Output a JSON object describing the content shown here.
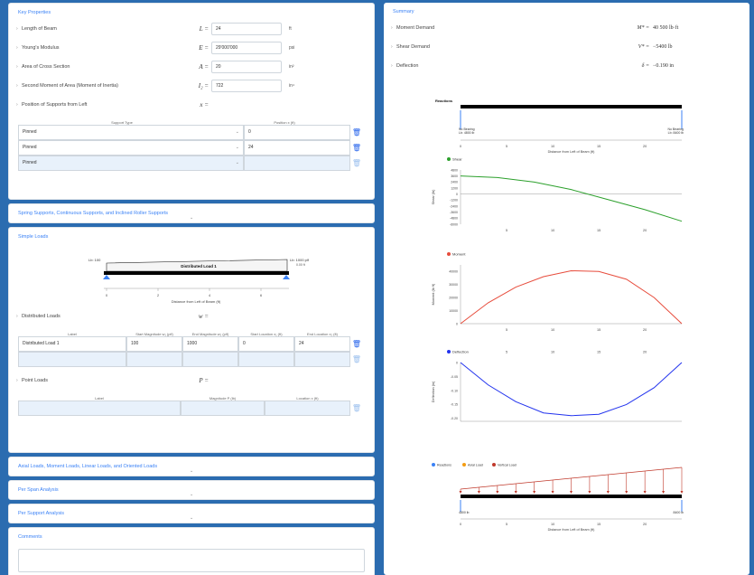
{
  "key_properties": {
    "header": "Key Properties",
    "rows": [
      {
        "label": "Length of Beam",
        "symbol": "L =",
        "value": "24",
        "unit": "ft"
      },
      {
        "label": "Young's Modulus",
        "symbol": "E =",
        "value": "29'000'000",
        "unit": "psi"
      },
      {
        "label": "Area of Cross Section",
        "symbol": "A =",
        "value": "20",
        "unit": "in²"
      },
      {
        "label": "Second Moment of Area (Moment of Inertia)",
        "symbol": "I₂ =",
        "value": "722",
        "unit": "in⁴"
      }
    ],
    "supports_label": "Position of Supports from Left",
    "supports_symbol": "x =",
    "support_type_header": "Support Type",
    "position_header": "Position x (ft)",
    "supports": [
      {
        "type": "Pinned",
        "position": "0"
      },
      {
        "type": "Pinned",
        "position": "24"
      },
      {
        "type": "Pinned",
        "position": ""
      }
    ]
  },
  "spring_section": {
    "label": "Spring Supports, Continuous Supports, and Inclined Roller Supports"
  },
  "simple_loads": {
    "header": "Simple Loads",
    "diagram": {
      "left_label": "Lb: 100",
      "right_label": "Lb: 1000 plf",
      "right_sublabel": "0.00 ft",
      "load_name": "Distributed Load 1",
      "ticks": [
        "0",
        "2",
        "4",
        "6"
      ],
      "xlabel": "Distance from Left of Beam (ft)"
    },
    "distributed_label": "Distributed Loads",
    "distributed_symbol": "w =",
    "dist_headers": [
      "Label",
      "Start Magnitude w₁ (plf)",
      "End Magnitude w₂ (plf)",
      "Start Location x₁ (ft)",
      "End Location x₂ (ft)"
    ],
    "dist_rows": [
      [
        "Distributed Load 1",
        "100",
        "1000",
        "0",
        "24"
      ],
      [
        "",
        "",
        "",
        "",
        ""
      ]
    ],
    "point_label": "Point Loads",
    "point_symbol": "P =",
    "point_headers": [
      "Label",
      "Magnitude P (lb)",
      "Location x (ft)"
    ],
    "point_rows": [
      [
        "",
        "",
        ""
      ]
    ]
  },
  "axial_section": {
    "label": "Axial Loads, Moment Loads, Linear Loads, and Oriented Loads"
  },
  "per_span": {
    "label": "Per Span Analysis"
  },
  "per_support": {
    "label": "Per Support Analysis"
  },
  "comments": {
    "header": "Comments",
    "value": ""
  },
  "summary": {
    "header": "Summary",
    "rows": [
      {
        "label": "Moment Demand",
        "symbol": "M* =",
        "value": "40 500 lb·ft"
      },
      {
        "label": "Shear Demand",
        "symbol": "V* =",
        "value": "−5400 lb"
      },
      {
        "label": "Deflection",
        "symbol": "δ =",
        "value": "−0.190 in"
      }
    ]
  },
  "reactions_chart": {
    "title": "Reactions",
    "left_label": "No Bearing\nLb: 4800 lb",
    "right_label": "No Bearing\nLb: 8400 lb",
    "ticks": [
      "0",
      "5",
      "10",
      "15",
      "20"
    ],
    "xlabel": "Distance from Left of Beam (ft)"
  },
  "colors": {
    "shear": "#2ca02c",
    "moment": "#e74c3c",
    "deflection": "#2233ee",
    "reaction": "#3b82f6",
    "load": "#c0392b",
    "accent": "#3b82f6"
  },
  "chart_data": [
    {
      "type": "line",
      "legend": "Shear",
      "ylabel": "Shear (lb)",
      "x": [
        0,
        4,
        8,
        12,
        16,
        20,
        24
      ],
      "y": [
        3600,
        3300,
        2400,
        900,
        -1100,
        -3100,
        -5400
      ],
      "yticks": [
        "4800",
        "3600",
        "2400",
        "1200",
        "0",
        "-1200",
        "-2400",
        "-3600",
        "-4800",
        "-6000"
      ],
      "xticks": [
        "5",
        "10",
        "15",
        "20"
      ]
    },
    {
      "type": "line",
      "legend": "Moment",
      "ylabel": "Moment (lb·ft)",
      "x": [
        0,
        3,
        6,
        9,
        12,
        15,
        18,
        21,
        24
      ],
      "y": [
        0,
        16000,
        28000,
        36000,
        40500,
        40000,
        34000,
        20000,
        0
      ],
      "yticks": [
        "40000",
        "30000",
        "20000",
        "10000",
        "0"
      ],
      "xticks": [
        "5",
        "10",
        "15",
        "20"
      ]
    },
    {
      "type": "line",
      "legend": "Deflection",
      "ylabel": "Deflection (in)",
      "x": [
        0,
        3,
        6,
        9,
        12,
        15,
        18,
        21,
        24
      ],
      "y": [
        0,
        -0.08,
        -0.14,
        -0.18,
        -0.19,
        -0.185,
        -0.15,
        -0.09,
        0
      ],
      "yticks": [
        "0",
        "-0.05",
        "-0.10",
        "-0.15",
        "-0.20"
      ],
      "xticks": [
        "5",
        "10",
        "15",
        "20"
      ]
    }
  ],
  "loads_chart": {
    "legend": [
      "Reactions",
      "Axial Load",
      "Vertical Load"
    ],
    "left_label": "4800 lb",
    "right_label": "8400 lb",
    "ticks": [
      "0",
      "5",
      "10",
      "15",
      "20"
    ],
    "xlabel": "Distance from Left of Beam (ft)"
  }
}
